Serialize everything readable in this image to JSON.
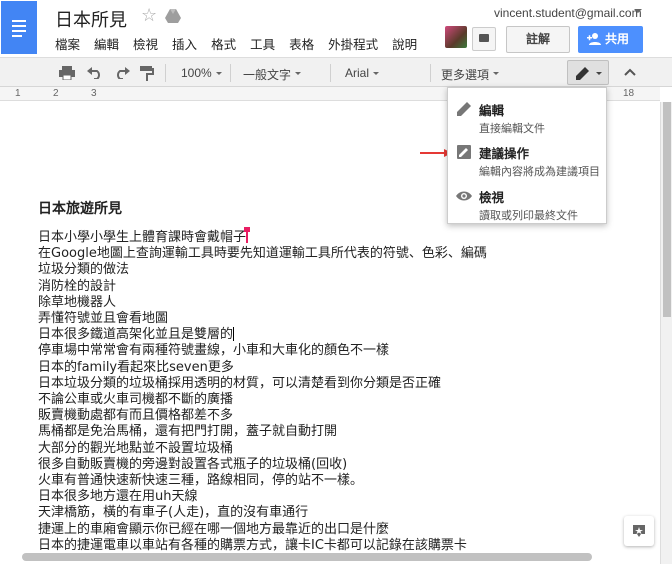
{
  "header": {
    "title": "日本所見",
    "account_email": "vincent.student@gmail.com",
    "comments_label": "註解",
    "share_label": "共用"
  },
  "menubar": [
    "檔案",
    "編輯",
    "檢視",
    "插入",
    "格式",
    "工具",
    "表格",
    "外掛程式",
    "說明"
  ],
  "toolbar": {
    "zoom": "100%",
    "style": "一般文字",
    "font": "Arial",
    "more": "更多選項"
  },
  "ruler": [
    "1",
    "2",
    "3",
    "18"
  ],
  "mode_menu": {
    "items": [
      {
        "title": "編輯",
        "desc": "直接編輯文件",
        "icon": "pencil-icon"
      },
      {
        "title": "建議操作",
        "desc": "編輯內容將成為建議項目",
        "icon": "suggest-icon"
      },
      {
        "title": "檢視",
        "desc": "讀取或列印最終文件",
        "icon": "eye-icon"
      }
    ]
  },
  "document": {
    "heading": "日本旅遊所見",
    "lines": [
      "日本小學小學生上體育課時會戴帽子",
      "在Google地圖上查詢運輸工具時要先知道運輸工具所代表的符號、色彩、編碼",
      "垃圾分類的做法",
      "消防栓的設計",
      "除草地機器人",
      "弄懂符號並且會看地圖",
      "日本很多鐵道高架化並且是雙層的",
      "停車場中常常會有兩種符號畫線，小車和大車化的顏色不一樣",
      "日本的family看起來比seven更多",
      "日本垃圾分類的垃圾桶採用透明的材質，可以清楚看到你分類是否正確",
      "不論公車或火車司機都不斷的廣播",
      "販賣機動處都有而且價格都差不多",
      "馬桶都是免治馬桶，還有把門打開，蓋子就自動打開",
      "大部分的觀光地點並不設置垃圾桶",
      "很多自動販賣機的旁邊對設置各式瓶子的垃圾桶(回收)",
      "火車有普通快速新快速三種，路線相同，停的站不一樣。",
      "日本很多地方還在用uh天線",
      "天津橋筋，橫的有車子(人走)，直的沒有車通行",
      "捷運上的車廂會顯示你已經在哪一個地方最靠近的出口是什麼",
      "日本的捷運電車以車站有各種的購票方式，讓卡IC卡都可以記錄在該購票卡"
    ]
  },
  "colors": {
    "accent_blue": "#4285f4",
    "share_blue": "#4d90fe",
    "cursor_pink": "#e91e63",
    "arrow_red": "#e53935"
  }
}
